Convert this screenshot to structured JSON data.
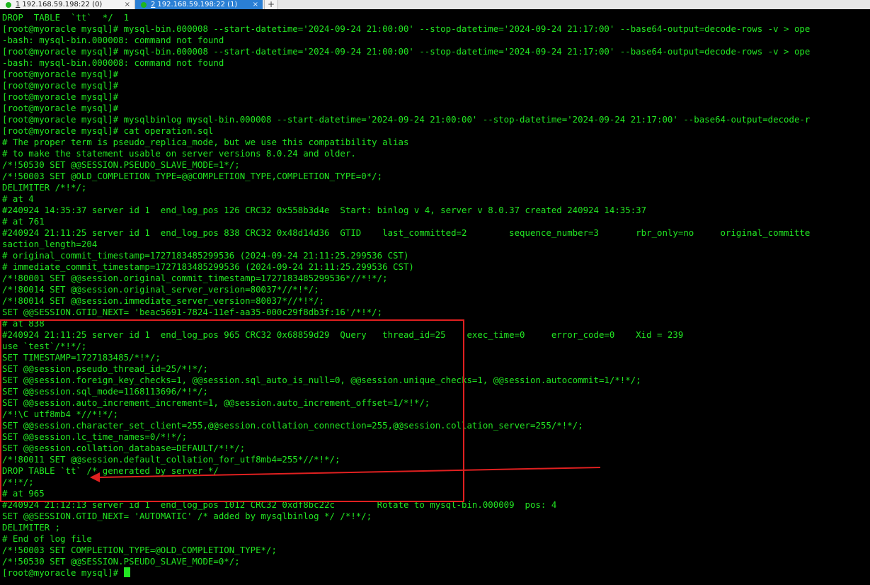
{
  "tabs": [
    {
      "number": "1",
      "label": "192.168.59.198:22 (0)",
      "close": "×"
    },
    {
      "number": "2",
      "label": "192.168.59.198:22 (1)",
      "close": "×"
    }
  ],
  "new_tab_label": "+",
  "terminal": {
    "lines": [
      "DROP  TABLE  `tt`  */  1",
      "[root@myoracle mysql]# mysql-bin.000008 --start-datetime='2024-09-24 21:00:00' --stop-datetime='2024-09-24 21:17:00' --base64-output=decode-rows -v > ope",
      "-bash: mysql-bin.000008: command not found",
      "[root@myoracle mysql]# mysql-bin.000008 --start-datetime='2024-09-24 21:00:00' --stop-datetime='2024-09-24 21:17:00' --base64-output=decode-rows -v > ope",
      "-bash: mysql-bin.000008: command not found",
      "[root@myoracle mysql]#",
      "[root@myoracle mysql]#",
      "[root@myoracle mysql]#",
      "[root@myoracle mysql]#",
      "[root@myoracle mysql]# mysqlbinlog mysql-bin.000008 --start-datetime='2024-09-24 21:00:00' --stop-datetime='2024-09-24 21:17:00' --base64-output=decode-r",
      "[root@myoracle mysql]# cat operation.sql",
      "# The proper term is pseudo_replica_mode, but we use this compatibility alias",
      "# to make the statement usable on server versions 8.0.24 and older.",
      "/*!50530 SET @@SESSION.PSEUDO_SLAVE_MODE=1*/;",
      "/*!50003 SET @OLD_COMPLETION_TYPE=@@COMPLETION_TYPE,COMPLETION_TYPE=0*/;",
      "DELIMITER /*!*/;",
      "# at 4",
      "#240924 14:35:37 server id 1  end_log_pos 126 CRC32 0x558b3d4e  Start: binlog v 4, server v 8.0.37 created 240924 14:35:37",
      "# at 761",
      "#240924 21:11:25 server id 1  end_log_pos 838 CRC32 0x48d14d36  GTID    last_committed=2        sequence_number=3       rbr_only=no     original_committe",
      "saction_length=204",
      "# original_commit_timestamp=1727183485299536 (2024-09-24 21:11:25.299536 CST)",
      "# immediate_commit_timestamp=1727183485299536 (2024-09-24 21:11:25.299536 CST)",
      "/*!80001 SET @@session.original_commit_timestamp=1727183485299536*//*!*/;",
      "/*!80014 SET @@session.original_server_version=80037*//*!*/;",
      "/*!80014 SET @@session.immediate_server_version=80037*//*!*/;",
      "SET @@SESSION.GTID_NEXT= 'beac5691-7824-11ef-aa35-000c29f8db3f:16'/*!*/;",
      "# at 838",
      "#240924 21:11:25 server id 1  end_log_pos 965 CRC32 0x68859d29  Query   thread_id=25    exec_time=0     error_code=0    Xid = 239",
      "use `test`/*!*/;",
      "SET TIMESTAMP=1727183485/*!*/;",
      "SET @@session.pseudo_thread_id=25/*!*/;",
      "SET @@session.foreign_key_checks=1, @@session.sql_auto_is_null=0, @@session.unique_checks=1, @@session.autocommit=1/*!*/;",
      "SET @@session.sql_mode=1168113696/*!*/;",
      "SET @@session.auto_increment_increment=1, @@session.auto_increment_offset=1/*!*/;",
      "/*!\\C utf8mb4 *//*!*/;",
      "SET @@session.character_set_client=255,@@session.collation_connection=255,@@session.collation_server=255/*!*/;",
      "SET @@session.lc_time_names=0/*!*/;",
      "SET @@session.collation_database=DEFAULT/*!*/;",
      "/*!80011 SET @@session.default_collation_for_utf8mb4=255*//*!*/;",
      "DROP TABLE `tt` /* generated by server */",
      "/*!*/;",
      "# at 965",
      "#240924 21:12:13 server id 1  end_log_pos 1012 CRC32 0xdf8bc22c        Rotate to mysql-bin.000009  pos: 4",
      "SET @@SESSION.GTID_NEXT= 'AUTOMATIC' /* added by mysqlbinlog */ /*!*/;",
      "DELIMITER ;",
      "# End of log file",
      "/*!50003 SET COMPLETION_TYPE=@OLD_COMPLETION_TYPE*/;",
      "/*!50530 SET @@SESSION.PSEUDO_SLAVE_MODE=0*/;"
    ],
    "prompt": "[root@myoracle mysql]# "
  },
  "colors": {
    "terminal_bg": "#000000",
    "terminal_fg": "#22e622",
    "annotation": "#e02020",
    "active_tab": "#2a7fd4"
  }
}
